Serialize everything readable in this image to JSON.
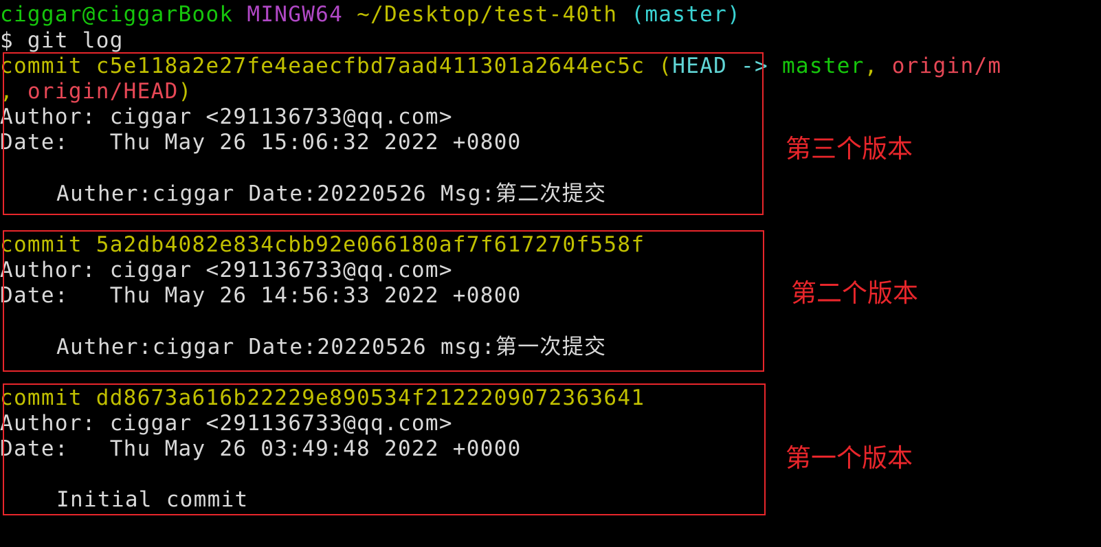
{
  "prompt": {
    "user_host": "ciggar@ciggarBook",
    "shell": "MINGW64",
    "path": "~/Desktop/test-40th",
    "branch": "(master)"
  },
  "command": "$ git log",
  "commits": [
    {
      "hash_line": "commit c5e118a2e27fe4eaecfbd7aad411301a2644ec5c",
      "refs_open": " (",
      "ref_head": "HEAD -> ",
      "ref_master": "master",
      "ref_sep": ", ",
      "ref_origin_trunc": "origin/m",
      "refs_wrap_prefix": ", ",
      "ref_origin_head": "origin/HEAD",
      "refs_close": ")",
      "author": "Author: ciggar <291136733@qq.com>",
      "date": "Date:   Thu May 26 15:06:32 2022 +0800",
      "message": "Auther:ciggar Date:20220526 Msg:第二次提交",
      "annotation": "第三个版本"
    },
    {
      "hash_line": "commit 5a2db4082e834cbb92e066180af7f617270f558f",
      "author": "Author: ciggar <291136733@qq.com>",
      "date": "Date:   Thu May 26 14:56:33 2022 +0800",
      "message": "Auther:ciggar Date:20220526 msg:第一次提交",
      "annotation": "第二个版本"
    },
    {
      "hash_line": "commit dd8673a616b22229e890534f2122209072363641",
      "author": "Author: ciggar <291136733@qq.com>",
      "date": "Date:   Thu May 26 03:49:48 2022 +0000",
      "message": "Initial commit",
      "annotation": "第一个版本"
    }
  ],
  "colors": {
    "background": "#000000",
    "text": "#d9d9d9",
    "prompt_user": "#16c60c",
    "prompt_shell": "#b148c6",
    "prompt_path": "#c1c000",
    "prompt_branch": "#3bd3d3",
    "commit_hash": "#c1c000",
    "ref_head": "#61d6d6",
    "ref_branch": "#16c60c",
    "ref_remote": "#e74856",
    "annotation": "#e8262b"
  }
}
